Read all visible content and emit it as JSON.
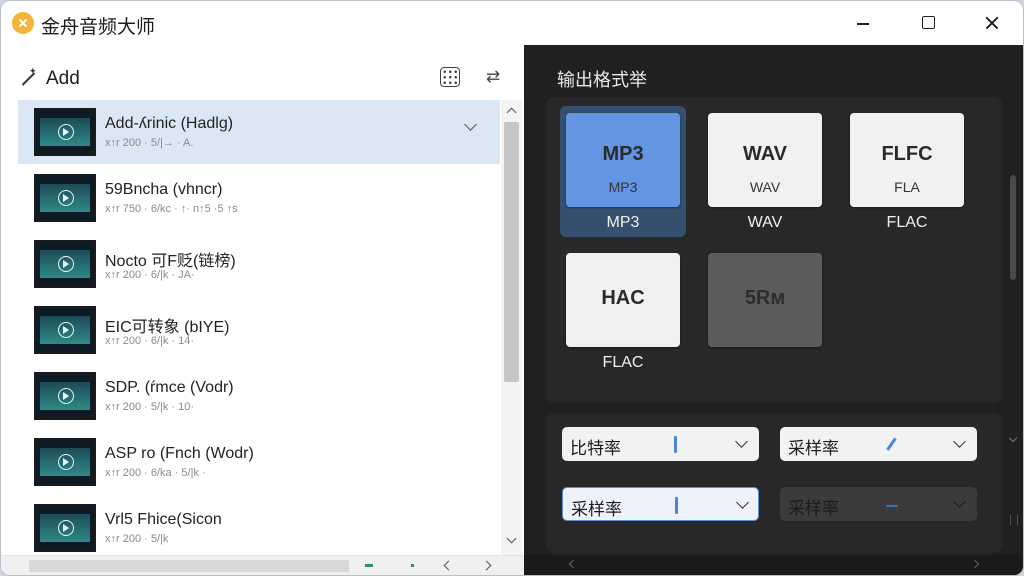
{
  "window": {
    "title": "金舟音频大师"
  },
  "left": {
    "add_label": "Add",
    "files": [
      {
        "name": "Add-ʎrinic (Hadlg)",
        "meta": "x↑r 200 · 5/|→ · A.",
        "selected": true
      },
      {
        "name": "59Bncha (vhncr)",
        "meta": "x↑r 750 · 6/kc · ↑· n↑5 ·5 ↑s",
        "selected": false
      },
      {
        "name": "Nocto 可F贬(链榜)",
        "meta": "x↑r 200 · 6/|k · JA·",
        "selected": false
      },
      {
        "name": "EIC可转象 (bIYE)",
        "meta": "x↑r 200 · 6/|k · 14·",
        "selected": false
      },
      {
        "name": "SDP. (ŕmce (Vodr)",
        "meta": "x↑r 200 · 5/|k · 10·",
        "selected": false
      },
      {
        "name": "ASP ro (Fnch (Wodr)",
        "meta": "x↑r 200 · 6/ka · 5/|k ·",
        "selected": false
      },
      {
        "name": "Vrl5 Fhice(Sicon",
        "meta": "x↑r 200 · 5/|k",
        "selected": false
      }
    ]
  },
  "right": {
    "section_title": "输出格式举",
    "formats": [
      {
        "big": "MP3",
        "small": "MP3",
        "caption": "MP3",
        "state": "selected"
      },
      {
        "big": "WAV",
        "small": "WAV",
        "caption": "WAV",
        "state": "normal"
      },
      {
        "big": "FLFC",
        "small": "FLA",
        "caption": "FLAC",
        "state": "normal"
      },
      {
        "big": "HAC",
        "small": "",
        "caption": "FLAC",
        "state": "normal"
      },
      {
        "big": "5Rм",
        "small": "",
        "caption": "",
        "state": "dim"
      }
    ],
    "settings": {
      "dd1_label": "比特率",
      "dd2_label": "采样率",
      "dd3_label": "采样率",
      "dd4_label": "采样率"
    }
  },
  "icons": {
    "app": "app-logo-icon",
    "add": "magic-wand-icon",
    "grid": "grid-view-icon",
    "swap": "swap-order-icon"
  },
  "colors": {
    "accent": "#6495e2",
    "selected_row": "#dbe7f5",
    "dark_bg": "#202020"
  }
}
